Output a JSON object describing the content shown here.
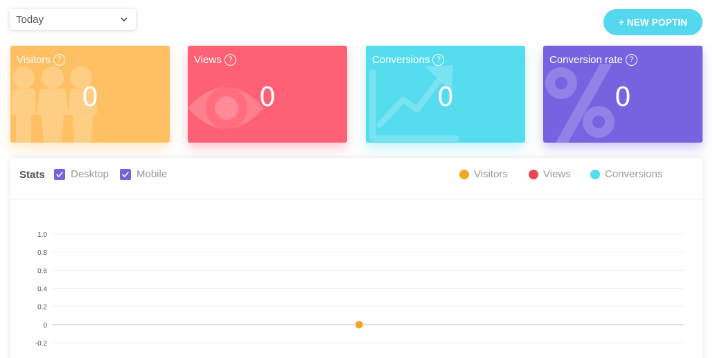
{
  "period": {
    "selected": "Today"
  },
  "header": {
    "new_button_label": "+ NEW POPTIN"
  },
  "cards": [
    {
      "title": "Visitors",
      "value": "0",
      "help": "?",
      "color": "#ffc063",
      "icon": "people-icon"
    },
    {
      "title": "Views",
      "value": "0",
      "help": "?",
      "color": "#ff6174",
      "icon": "eye-icon"
    },
    {
      "title": "Conversions",
      "value": "0",
      "help": "?",
      "color": "#55dcee",
      "icon": "trend-up-icon"
    },
    {
      "title": "Conversion rate",
      "value": "0",
      "help": "?",
      "color": "#7762e0",
      "icon": "percent-icon"
    }
  ],
  "stats": {
    "label": "Stats",
    "filters": [
      {
        "label": "Desktop",
        "checked": true
      },
      {
        "label": "Mobile",
        "checked": true
      }
    ],
    "legend": [
      {
        "label": "Visitors",
        "color": "#f5a623"
      },
      {
        "label": "Views",
        "color": "#e8474f"
      },
      {
        "label": "Conversions",
        "color": "#55dcee"
      }
    ]
  },
  "chart_data": {
    "type": "line",
    "ylim": [
      -0.2,
      1.0
    ],
    "yticks": [
      "1.0",
      "0.8",
      "0.6",
      "0.4",
      "0.2",
      "0",
      "-0.2"
    ],
    "grid": true,
    "series": [
      {
        "name": "Visitors",
        "values": [
          0
        ],
        "color": "#f5a623"
      }
    ]
  }
}
